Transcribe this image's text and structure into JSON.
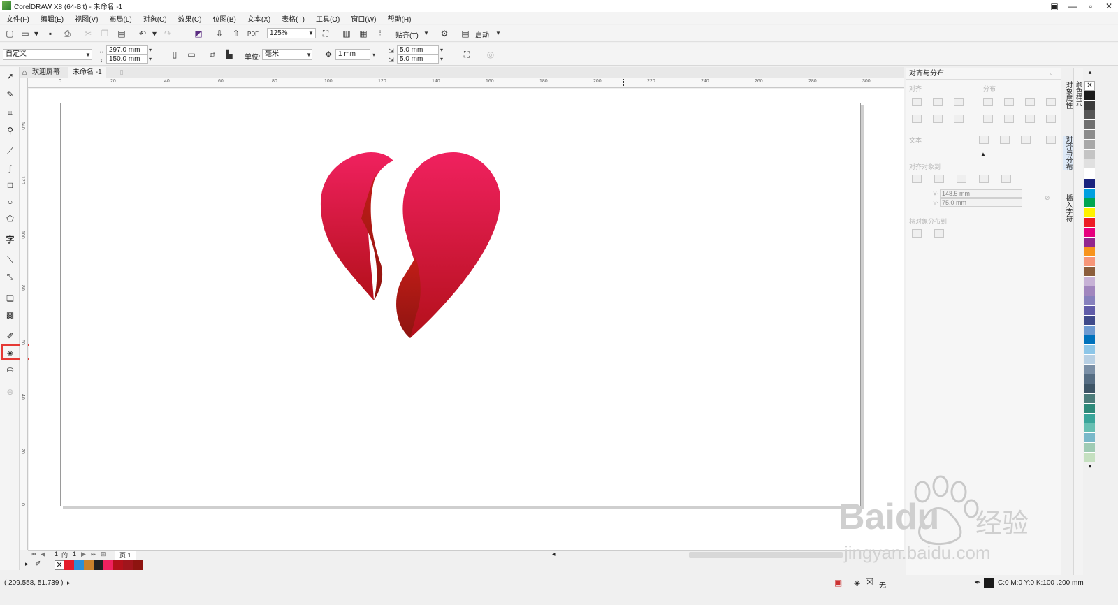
{
  "window": {
    "title": "CorelDRAW X8 (64-Bit) - 未命名 -1",
    "controls": [
      "—",
      "▫",
      "✕"
    ]
  },
  "menu": [
    "文件(F)",
    "编辑(E)",
    "视图(V)",
    "布局(L)",
    "对象(C)",
    "效果(C)",
    "位图(B)",
    "文本(X)",
    "表格(T)",
    "工具(O)",
    "窗口(W)",
    "帮助(H)"
  ],
  "toolbar1": {
    "zoom": "125%",
    "snap_label": "贴齐(T)",
    "launch_label": "启动",
    "pdf_label": "PDF"
  },
  "toolbar2": {
    "page_preset": "自定义",
    "width": "297.0 mm",
    "height": "150.0 mm",
    "unit_label": "单位:",
    "unit_value": "毫米",
    "nudge": "1 mm",
    "dup_x": "5.0 mm",
    "dup_y": "5.0 mm"
  },
  "doc_tabs": [
    {
      "label": "欢迎屏幕"
    },
    {
      "label": "未命名 -1"
    }
  ],
  "ruler_h": [
    "0",
    "20",
    "40",
    "60",
    "80",
    "100",
    "120",
    "140",
    "160",
    "180",
    "200",
    "220",
    "240",
    "260",
    "280",
    "300"
  ],
  "ruler_v": [
    "140",
    "120",
    "100",
    "80",
    "60",
    "40",
    "20",
    "0"
  ],
  "page_nav": {
    "current": "1",
    "of": "的",
    "total": "1",
    "page_tab": "页 1"
  },
  "status": {
    "coords": "( 209.558, 51.739 )",
    "fill_none": "无",
    "outline": "C:0 M:0 Y:0 K:100  .200 mm"
  },
  "docker": {
    "title": "对齐与分布",
    "sec_align": "对齐",
    "sec_distribute": "分布",
    "sec_text": "文本",
    "sec_align_to": "对齐对象到",
    "x_label": "X:",
    "x_value": "148.5 mm",
    "y_label": "Y:",
    "y_value": "75.0 mm",
    "sec_distribute_to": "将对象分布到",
    "side_tabs": [
      "对象属性",
      "对齐与分布",
      "插入字符"
    ],
    "far_tab": "颜色样式"
  },
  "colors": {
    "accent_red": "#e53935",
    "heart_top": "#f0215f",
    "heart_bottom": "#b3101a",
    "ribbon_dark": "#8e1410"
  },
  "watermark": {
    "brand": "Baidu",
    "cn": "经验",
    "url": "jingyan.baidu.com"
  }
}
